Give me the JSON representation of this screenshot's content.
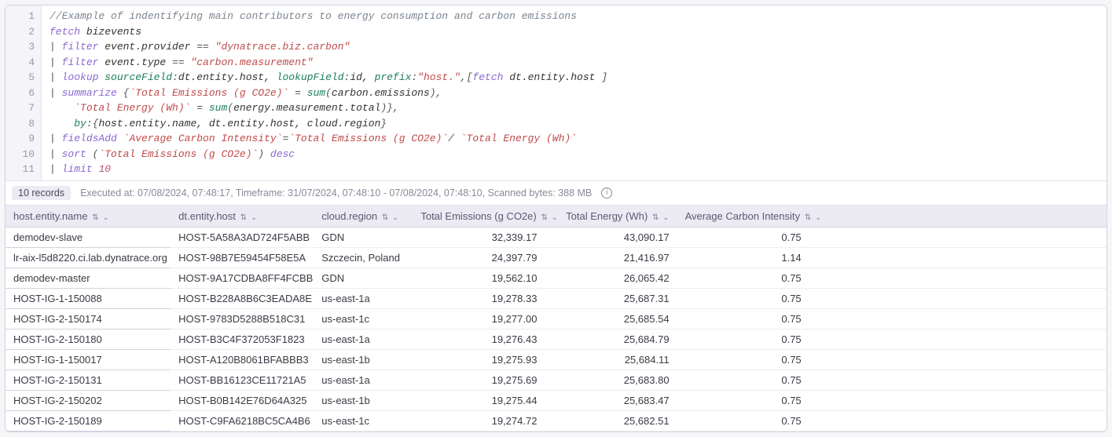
{
  "editor": {
    "lines": [
      [
        {
          "cls": "tk-comment",
          "t": "//Example of indentifying main contributors to energy consumption and carbon emissions"
        }
      ],
      [
        {
          "cls": "tk-kw",
          "t": "fetch"
        },
        {
          "cls": "tk-ident",
          "t": " bizevents"
        }
      ],
      [
        {
          "cls": "tk-punc",
          "t": "| "
        },
        {
          "cls": "tk-kw",
          "t": "filter"
        },
        {
          "cls": "tk-ident",
          "t": " event.provider "
        },
        {
          "cls": "tk-punc",
          "t": "== "
        },
        {
          "cls": "tk-str",
          "t": "\"dynatrace.biz.carbon\""
        }
      ],
      [
        {
          "cls": "tk-punc",
          "t": "| "
        },
        {
          "cls": "tk-kw",
          "t": "filter"
        },
        {
          "cls": "tk-ident",
          "t": " event.type "
        },
        {
          "cls": "tk-punc",
          "t": "== "
        },
        {
          "cls": "tk-str",
          "t": "\"carbon.measurement\""
        }
      ],
      [
        {
          "cls": "tk-punc",
          "t": "| "
        },
        {
          "cls": "tk-kw",
          "t": "lookup"
        },
        {
          "cls": "tk-ident",
          "t": " "
        },
        {
          "cls": "tk-call",
          "t": "sourceField"
        },
        {
          "cls": "tk-punc",
          "t": ":"
        },
        {
          "cls": "tk-ident",
          "t": "dt.entity.host, "
        },
        {
          "cls": "tk-call",
          "t": "lookupField"
        },
        {
          "cls": "tk-punc",
          "t": ":"
        },
        {
          "cls": "tk-ident",
          "t": "id, "
        },
        {
          "cls": "tk-call",
          "t": "prefix"
        },
        {
          "cls": "tk-punc",
          "t": ":"
        },
        {
          "cls": "tk-str",
          "t": "\"host.\""
        },
        {
          "cls": "tk-punc",
          "t": ",["
        },
        {
          "cls": "tk-kw",
          "t": "fetch"
        },
        {
          "cls": "tk-ident",
          "t": " dt.entity.host "
        },
        {
          "cls": "tk-punc",
          "t": "]"
        }
      ],
      [
        {
          "cls": "tk-punc",
          "t": "| "
        },
        {
          "cls": "tk-kw",
          "t": "summarize"
        },
        {
          "cls": "tk-punc",
          "t": " {"
        },
        {
          "cls": "tk-str",
          "t": "`Total Emissions (g CO2e)`"
        },
        {
          "cls": "tk-punc",
          "t": " = "
        },
        {
          "cls": "tk-call",
          "t": "sum"
        },
        {
          "cls": "tk-punc",
          "t": "("
        },
        {
          "cls": "tk-ident",
          "t": "carbon.emissions"
        },
        {
          "cls": "tk-punc",
          "t": "),"
        }
      ],
      [
        {
          "cls": "tk-punc",
          "t": "    "
        },
        {
          "cls": "tk-str",
          "t": "`Total Energy (Wh)`"
        },
        {
          "cls": "tk-punc",
          "t": " = "
        },
        {
          "cls": "tk-call",
          "t": "sum"
        },
        {
          "cls": "tk-punc",
          "t": "("
        },
        {
          "cls": "tk-ident",
          "t": "energy.measurement.total"
        },
        {
          "cls": "tk-punc",
          "t": ")},"
        }
      ],
      [
        {
          "cls": "tk-punc",
          "t": "    "
        },
        {
          "cls": "tk-call",
          "t": "by"
        },
        {
          "cls": "tk-punc",
          "t": ":{"
        },
        {
          "cls": "tk-ident",
          "t": "host.entity.name, dt.entity.host, cloud.region"
        },
        {
          "cls": "tk-punc",
          "t": "}"
        }
      ],
      [
        {
          "cls": "tk-punc",
          "t": "| "
        },
        {
          "cls": "tk-kw",
          "t": "fieldsAdd"
        },
        {
          "cls": "tk-ident",
          "t": " "
        },
        {
          "cls": "tk-str",
          "t": "`Average Carbon Intensity`"
        },
        {
          "cls": "tk-punc",
          "t": "="
        },
        {
          "cls": "tk-str",
          "t": "`Total Emissions (g CO2e)`"
        },
        {
          "cls": "tk-punc",
          "t": "/ "
        },
        {
          "cls": "tk-str",
          "t": "`Total Energy (Wh)`"
        }
      ],
      [
        {
          "cls": "tk-punc",
          "t": "| "
        },
        {
          "cls": "tk-kw",
          "t": "sort"
        },
        {
          "cls": "tk-punc",
          "t": " ("
        },
        {
          "cls": "tk-str",
          "t": "`Total Emissions (g CO2e)`"
        },
        {
          "cls": "tk-punc",
          "t": ") "
        },
        {
          "cls": "tk-kw",
          "t": "desc"
        }
      ],
      [
        {
          "cls": "tk-punc",
          "t": "| "
        },
        {
          "cls": "tk-kw",
          "t": "limit"
        },
        {
          "cls": "tk-ident",
          "t": " "
        },
        {
          "cls": "tk-num",
          "t": "10"
        }
      ]
    ]
  },
  "status": {
    "records_chip": "10 records",
    "executed": "Executed at: 07/08/2024, 07:48:17, Timeframe: 31/07/2024, 07:48:10 - 07/08/2024, 07:48:10, Scanned bytes: 388 MB"
  },
  "table": {
    "columns": [
      "host.entity.name",
      "dt.entity.host",
      "cloud.region",
      "Total Emissions (g CO2e)",
      "Total Energy (Wh)",
      "Average Carbon Intensity"
    ],
    "rows": [
      {
        "name": "demodev-slave",
        "host": "HOST-5A58A3AD724F5ABB",
        "region": "GDN",
        "emissions": "32,339.17",
        "energy": "43,090.17",
        "intensity": "0.75"
      },
      {
        "name": "lr-aix-l5d8220.ci.lab.dynatrace.org",
        "host": "HOST-98B7E59454F58E5A",
        "region": "Szczecin, Poland",
        "emissions": "24,397.79",
        "energy": "21,416.97",
        "intensity": "1.14"
      },
      {
        "name": "demodev-master",
        "host": "HOST-9A17CDBA8FF4FCBB",
        "region": "GDN",
        "emissions": "19,562.10",
        "energy": "26,065.42",
        "intensity": "0.75"
      },
      {
        "name": "HOST-IG-1-150088",
        "host": "HOST-B228A8B6C3EADA8E",
        "region": "us-east-1a",
        "emissions": "19,278.33",
        "energy": "25,687.31",
        "intensity": "0.75"
      },
      {
        "name": "HOST-IG-2-150174",
        "host": "HOST-9783D5288B518C31",
        "region": "us-east-1c",
        "emissions": "19,277.00",
        "energy": "25,685.54",
        "intensity": "0.75"
      },
      {
        "name": "HOST-IG-2-150180",
        "host": "HOST-B3C4F372053F1823",
        "region": "us-east-1a",
        "emissions": "19,276.43",
        "energy": "25,684.79",
        "intensity": "0.75"
      },
      {
        "name": "HOST-IG-1-150017",
        "host": "HOST-A120B8061BFABBB3",
        "region": "us-east-1b",
        "emissions": "19,275.93",
        "energy": "25,684.11",
        "intensity": "0.75"
      },
      {
        "name": "HOST-IG-2-150131",
        "host": "HOST-BB16123CE11721A5",
        "region": "us-east-1a",
        "emissions": "19,275.69",
        "energy": "25,683.80",
        "intensity": "0.75"
      },
      {
        "name": "HOST-IG-2-150202",
        "host": "HOST-B0B142E76D64A325",
        "region": "us-east-1b",
        "emissions": "19,275.44",
        "energy": "25,683.47",
        "intensity": "0.75"
      },
      {
        "name": "HOST-IG-2-150189",
        "host": "HOST-C9FA6218BC5CA4B6",
        "region": "us-east-1c",
        "emissions": "19,274.72",
        "energy": "25,682.51",
        "intensity": "0.75"
      }
    ]
  },
  "glyphs": {
    "sort": "⇅",
    "chev": "⌄",
    "info": "i"
  }
}
